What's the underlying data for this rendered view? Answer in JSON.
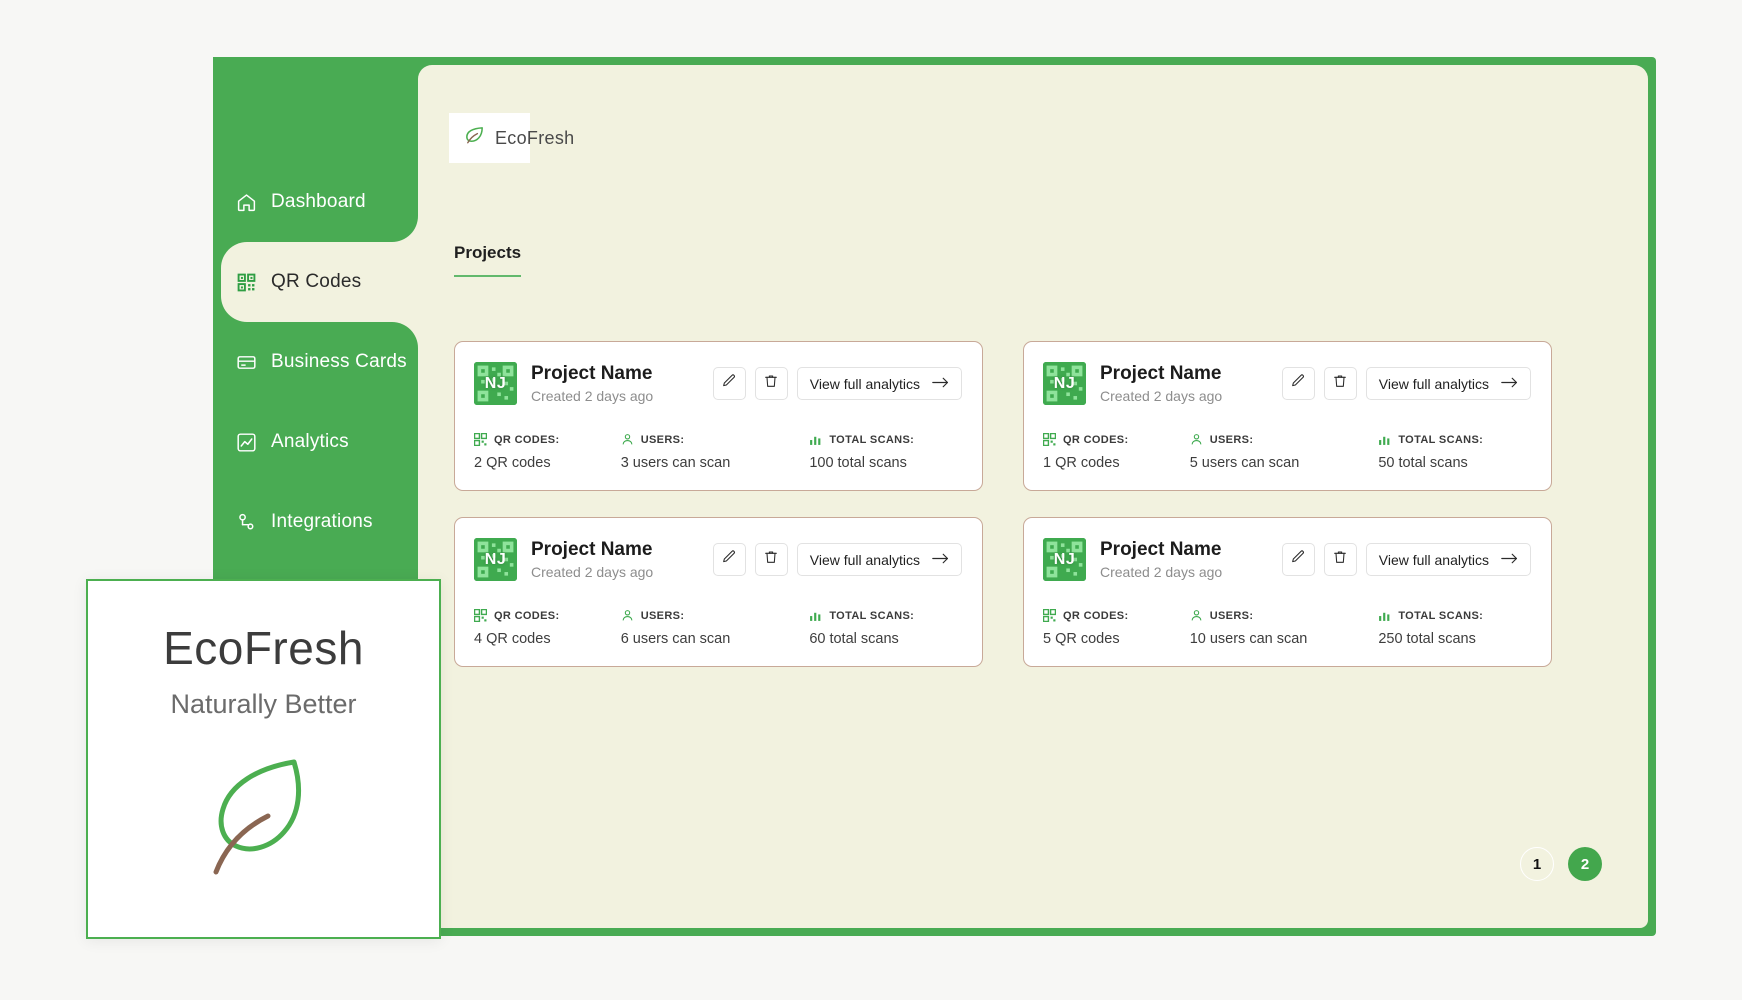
{
  "brand": {
    "name": "EcoFresh",
    "logo_icon": "leaf-icon",
    "accent": "#49ab53"
  },
  "sidebar": {
    "items": [
      {
        "label": "Dashboard",
        "icon": "home-icon",
        "active": false
      },
      {
        "label": "QR Codes",
        "icon": "qr-code-icon",
        "active": true
      },
      {
        "label": "Business Cards",
        "icon": "credit-card-icon",
        "active": false
      },
      {
        "label": "Analytics",
        "icon": "chart-icon",
        "active": false
      },
      {
        "label": "Integrations",
        "icon": "nodes-icon",
        "active": false
      }
    ]
  },
  "tabs": [
    {
      "label": "Projects",
      "active": true
    }
  ],
  "card_actions": {
    "edit_icon": "pencil-icon",
    "delete_icon": "trash-icon",
    "analytics_label": "View full analytics",
    "analytics_arrow": "arrow-right-icon"
  },
  "stat_labels": {
    "qr_codes": "QR CODES:",
    "users": "USERS:",
    "total_scans": "TOTAL SCANS:",
    "qr_icon": "qr-code-icon",
    "users_icon": "user-icon",
    "scans_icon": "bar-chart-icon"
  },
  "projects": [
    {
      "initials": "NJ",
      "title": "Project Name",
      "created": "Created 2 days ago",
      "qr_codes": "2 QR codes",
      "users": "3 users can scan",
      "scans": "100 total scans"
    },
    {
      "initials": "NJ",
      "title": "Project Name",
      "created": "Created 2 days ago",
      "qr_codes": "1 QR codes",
      "users": "5 users can scan",
      "scans": "50 total scans"
    },
    {
      "initials": "NJ",
      "title": "Project Name",
      "created": "Created 2 days ago",
      "qr_codes": "4 QR codes",
      "users": "6 users can scan",
      "scans": "60 total scans"
    },
    {
      "initials": "NJ",
      "title": "Project Name",
      "created": "Created 2 days ago",
      "qr_codes": "5 QR codes",
      "users": "10 users can scan",
      "scans": "250 total scans"
    }
  ],
  "pagination": [
    {
      "label": "1",
      "active": false
    },
    {
      "label": "2",
      "active": true
    }
  ],
  "business_card": {
    "title": "EcoFresh",
    "tagline": "Naturally Better",
    "logo_icon": "leaf-icon",
    "border_color": "#4caf50"
  }
}
